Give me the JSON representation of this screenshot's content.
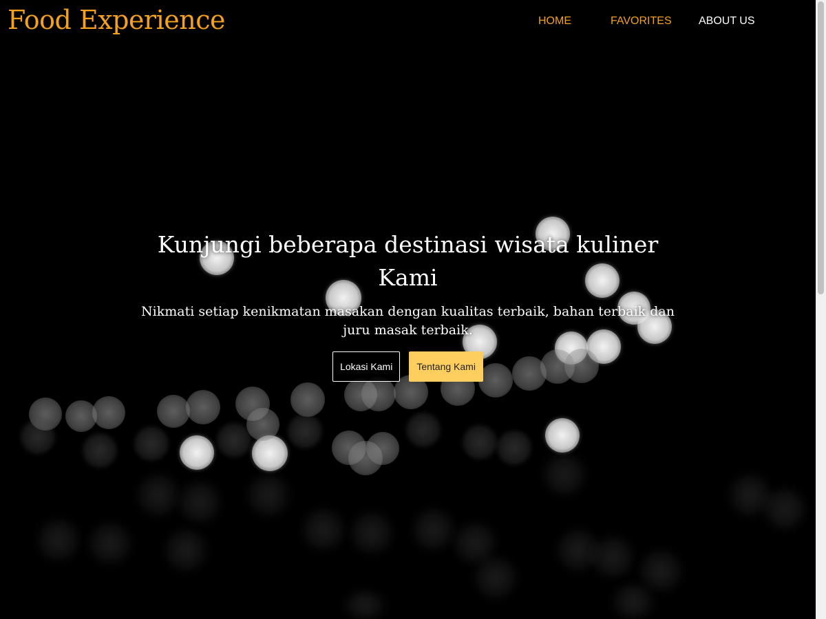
{
  "brand": {
    "name": "Food Experience",
    "color": "#f5a01e"
  },
  "nav": {
    "items": [
      {
        "label": "HOME",
        "color": "#f5a01e"
      },
      {
        "label": "FAVORITES",
        "color": "#f5a01e"
      },
      {
        "label": "ABOUT US",
        "color": "#ffffff"
      }
    ]
  },
  "hero": {
    "title": "Kunjungi beberapa destinasi wisata kuliner Kami",
    "subtitle": "Nikmati setiap kenikmatan masakan dengan kualitas terbaik, bahan terbaik dan juru masak terbaik.",
    "buttons": {
      "primary_label": "Lokasi Kami",
      "secondary_label": "Tentang Kami"
    },
    "background": "bokeh-lights-image"
  },
  "colors": {
    "accent": "#f5a01e",
    "button_yellow": "#fecf5f",
    "background": "#000000"
  }
}
